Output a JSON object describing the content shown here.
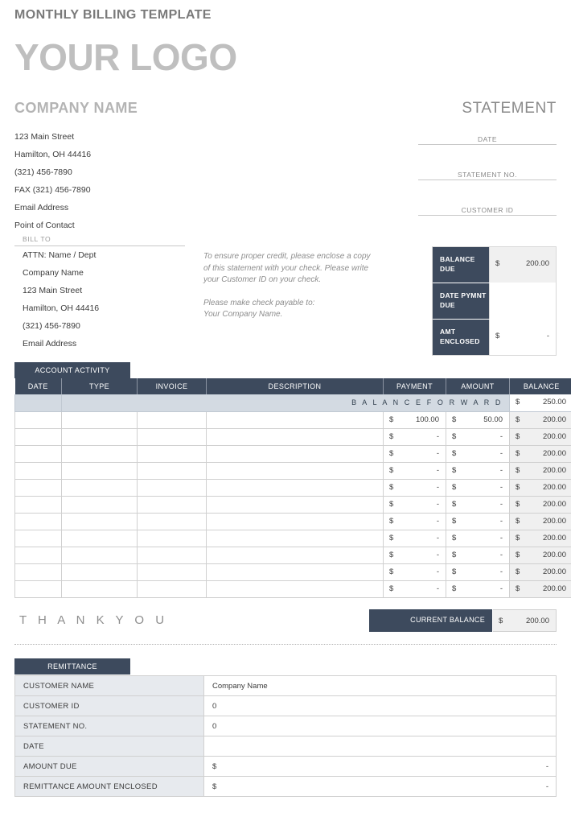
{
  "header": {
    "doc_title": "MONTHLY BILLING TEMPLATE",
    "logo": "YOUR LOGO",
    "company_name": "COMPANY NAME",
    "statement_word": "STATEMENT"
  },
  "company_address": [
    "123 Main Street",
    "Hamilton, OH 44416",
    "(321) 456-7890",
    "FAX (321) 456-7890",
    "Email Address",
    "Point of Contact"
  ],
  "statement_fields": [
    {
      "label": "DATE",
      "value": ""
    },
    {
      "label": "STATEMENT NO.",
      "value": ""
    },
    {
      "label": "CUSTOMER ID",
      "value": ""
    }
  ],
  "bill_to": {
    "label": "BILL TO",
    "lines": [
      "ATTN: Name / Dept",
      "Company Name",
      "123 Main Street",
      "Hamilton, OH  44416",
      "(321) 456-7890",
      "Email Address"
    ]
  },
  "note": {
    "paragraph1": "To ensure proper credit, please enclose a copy of this statement with your check. Please write your Customer ID on your check.",
    "paragraph2_line1": "Please make check payable to:",
    "paragraph2_line2": "Your Company Name."
  },
  "balance_box": [
    {
      "key": "BALANCE DUE",
      "currency": "$",
      "amount": "200.00",
      "shaded": true
    },
    {
      "key": "DATE PYMNT DUE",
      "currency": "",
      "amount": "",
      "shaded": false
    },
    {
      "key": "AMT ENCLOSED",
      "currency": "$",
      "amount": "-",
      "shaded": false
    }
  ],
  "activity": {
    "tab_label": "ACCOUNT ACTIVITY",
    "columns": [
      "DATE",
      "TYPE",
      "INVOICE",
      "DESCRIPTION",
      "PAYMENT",
      "AMOUNT",
      "BALANCE"
    ],
    "balance_forward": {
      "label": "B A L A N C E    F O R W A R D",
      "currency": "$",
      "amount": "250.00"
    },
    "rows": [
      {
        "date": "",
        "type": "",
        "invoice": "",
        "description": "",
        "payment": "100.00",
        "amount": "50.00",
        "balance": "200.00"
      },
      {
        "date": "",
        "type": "",
        "invoice": "",
        "description": "",
        "payment": "-",
        "amount": "-",
        "balance": "200.00"
      },
      {
        "date": "",
        "type": "",
        "invoice": "",
        "description": "",
        "payment": "-",
        "amount": "-",
        "balance": "200.00"
      },
      {
        "date": "",
        "type": "",
        "invoice": "",
        "description": "",
        "payment": "-",
        "amount": "-",
        "balance": "200.00"
      },
      {
        "date": "",
        "type": "",
        "invoice": "",
        "description": "",
        "payment": "-",
        "amount": "-",
        "balance": "200.00"
      },
      {
        "date": "",
        "type": "",
        "invoice": "",
        "description": "",
        "payment": "-",
        "amount": "-",
        "balance": "200.00"
      },
      {
        "date": "",
        "type": "",
        "invoice": "",
        "description": "",
        "payment": "-",
        "amount": "-",
        "balance": "200.00"
      },
      {
        "date": "",
        "type": "",
        "invoice": "",
        "description": "",
        "payment": "-",
        "amount": "-",
        "balance": "200.00"
      },
      {
        "date": "",
        "type": "",
        "invoice": "",
        "description": "",
        "payment": "-",
        "amount": "-",
        "balance": "200.00"
      },
      {
        "date": "",
        "type": "",
        "invoice": "",
        "description": "",
        "payment": "-",
        "amount": "-",
        "balance": "200.00"
      },
      {
        "date": "",
        "type": "",
        "invoice": "",
        "description": "",
        "payment": "-",
        "amount": "-",
        "balance": "200.00"
      }
    ],
    "currency_symbol": "$"
  },
  "footer": {
    "thank_you": "T H A N K   Y O U",
    "current_balance_label": "CURRENT BALANCE",
    "current_balance_currency": "$",
    "current_balance_amount": "200.00"
  },
  "remittance": {
    "tab_label": "REMITTANCE",
    "rows": [
      {
        "key": "CUSTOMER NAME",
        "value": "Company Name",
        "currency": "",
        "dash": ""
      },
      {
        "key": "CUSTOMER ID",
        "value": "0",
        "currency": "",
        "dash": ""
      },
      {
        "key": "STATEMENT NO.",
        "value": "0",
        "currency": "",
        "dash": ""
      },
      {
        "key": "DATE",
        "value": "",
        "currency": "",
        "dash": ""
      },
      {
        "key": "AMOUNT DUE",
        "value": "",
        "currency": "$",
        "dash": "-"
      },
      {
        "key": "REMITTANCE AMOUNT ENCLOSED",
        "value": "",
        "currency": "$",
        "dash": "-"
      }
    ]
  },
  "colors": {
    "navy": "#3d4a5d",
    "muted_gray": "#8d8d8d",
    "logo_gray": "#bfbfbf",
    "row_shade": "#f0f0f0",
    "forward_shade": "#d3dae2",
    "remit_key_shade": "#e7eaee"
  }
}
